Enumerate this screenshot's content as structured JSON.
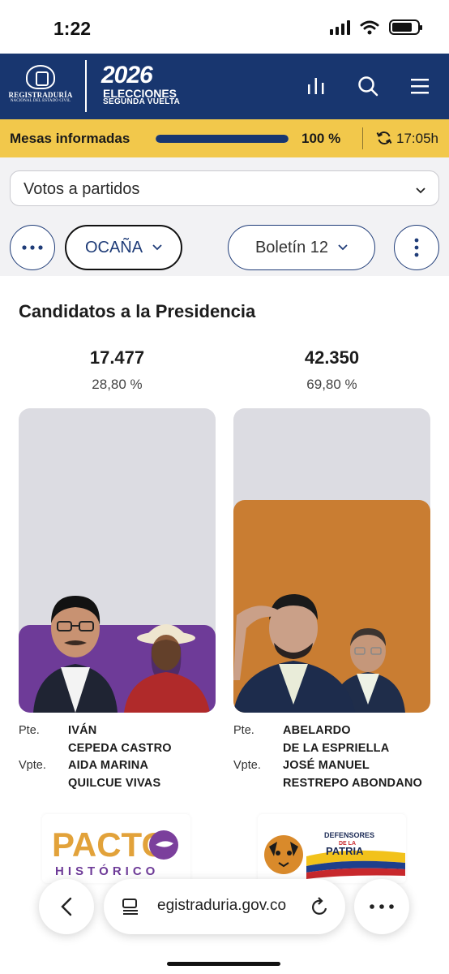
{
  "status_bar": {
    "time": "1:22",
    "battery_level": 0.8
  },
  "header": {
    "logo_name": "REGISTRADURÍA",
    "logo_sub": "NACIONAL DEL ESTADO CIVIL",
    "year": "2026",
    "title": "ELECCIONES",
    "round": "SEGUNDA VUELTA",
    "icons": [
      "bar-chart-icon",
      "search-icon",
      "menu-icon"
    ],
    "brand_color": "#18366f"
  },
  "progress": {
    "label": "Mesas informadas",
    "value": 1.0,
    "percent_text": "100 %",
    "time": "17:05h",
    "accent": "#f2c84b"
  },
  "filters": {
    "vote_type": "Votos a partidos",
    "city": "OCAÑA",
    "bulletin": "Boletín 12"
  },
  "section_title": "Candidatos a la Presidencia",
  "candidates": [
    {
      "votes": "17.477",
      "percent": "28,80 %",
      "share": 28.8,
      "color": "#6e3b98",
      "president_role": "Pte.",
      "president": [
        "IVÁN",
        "CEPEDA CASTRO"
      ],
      "vice_role": "Vpte.",
      "vice": [
        "AIDA MARINA",
        "QUILCUE VIVAS"
      ],
      "party_logo": {
        "name": "PACTO",
        "sub": "HISTÓRICO"
      }
    },
    {
      "votes": "42.350",
      "percent": "69,80 %",
      "share": 69.8,
      "color": "#c97d32",
      "president_role": "Pte.",
      "president": [
        "ABELARDO",
        "DE LA ESPRIELLA"
      ],
      "vice_role": "Vpte.",
      "vice": [
        "JOSÉ MANUEL",
        "RESTREPO ABONDANO"
      ],
      "party_logo": {
        "name": "DEFENSORES",
        "mid": "DE LA",
        "sub": "PATRIA"
      }
    }
  ],
  "browser": {
    "url": "egistraduria.gov.co"
  }
}
